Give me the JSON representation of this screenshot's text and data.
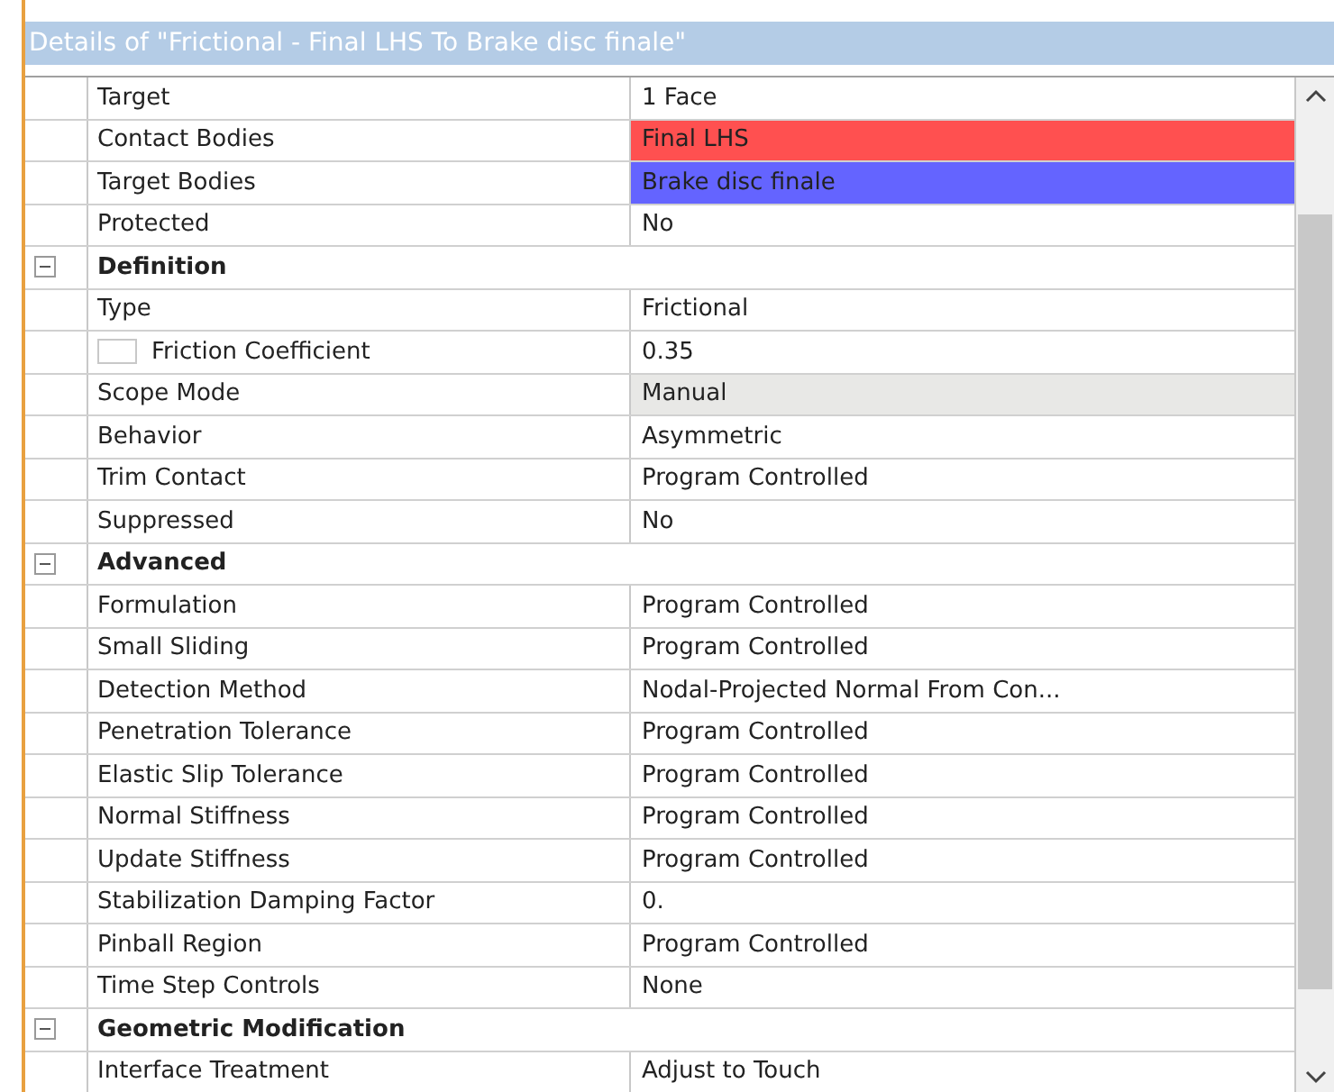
{
  "window": {
    "title": "Details of \"Frictional - Final LHS To Brake disc finale\""
  },
  "sections": [
    {
      "rows": [
        {
          "name": "Target",
          "value": "1 Face",
          "kind": "plain"
        },
        {
          "name": "Contact Bodies",
          "value": "Final LHS",
          "kind": "colored",
          "color": "#ff5050"
        },
        {
          "name": "Target Bodies",
          "value": "Brake disc finale",
          "kind": "colored",
          "color": "#6464ff"
        },
        {
          "name": "Protected",
          "value": "No",
          "kind": "plain"
        }
      ]
    },
    {
      "header": "Definition",
      "expanded": true,
      "rows": [
        {
          "name": "Type",
          "value": "Frictional",
          "kind": "plain"
        },
        {
          "name": "Friction Coefficient",
          "value": "0.35",
          "kind": "checkbox",
          "checked": false
        },
        {
          "name": "Scope Mode",
          "value": "Manual",
          "kind": "readonly"
        },
        {
          "name": "Behavior",
          "value": "Asymmetric",
          "kind": "plain"
        },
        {
          "name": "Trim Contact",
          "value": "Program Controlled",
          "kind": "plain"
        },
        {
          "name": "Suppressed",
          "value": "No",
          "kind": "plain"
        }
      ]
    },
    {
      "header": "Advanced",
      "expanded": true,
      "rows": [
        {
          "name": "Formulation",
          "value": "Program Controlled",
          "kind": "plain"
        },
        {
          "name": "Small Sliding",
          "value": "Program Controlled",
          "kind": "plain"
        },
        {
          "name": "Detection Method",
          "value": "Nodal-Projected Normal From Con...",
          "kind": "plain"
        },
        {
          "name": "Penetration Tolerance",
          "value": "Program Controlled",
          "kind": "plain"
        },
        {
          "name": "Elastic Slip Tolerance",
          "value": "Program Controlled",
          "kind": "plain"
        },
        {
          "name": "Normal Stiffness",
          "value": "Program Controlled",
          "kind": "plain"
        },
        {
          "name": "Update Stiffness",
          "value": "Program Controlled",
          "kind": "plain"
        },
        {
          "name": "Stabilization Damping Factor",
          "value": "0.",
          "kind": "plain"
        },
        {
          "name": "Pinball Region",
          "value": "Program Controlled",
          "kind": "plain"
        },
        {
          "name": "Time Step Controls",
          "value": "None",
          "kind": "plain"
        }
      ]
    },
    {
      "header": "Geometric Modification",
      "expanded": true,
      "rows": [
        {
          "name": "Interface Treatment",
          "value": "Adjust to Touch",
          "kind": "plain"
        }
      ]
    }
  ]
}
